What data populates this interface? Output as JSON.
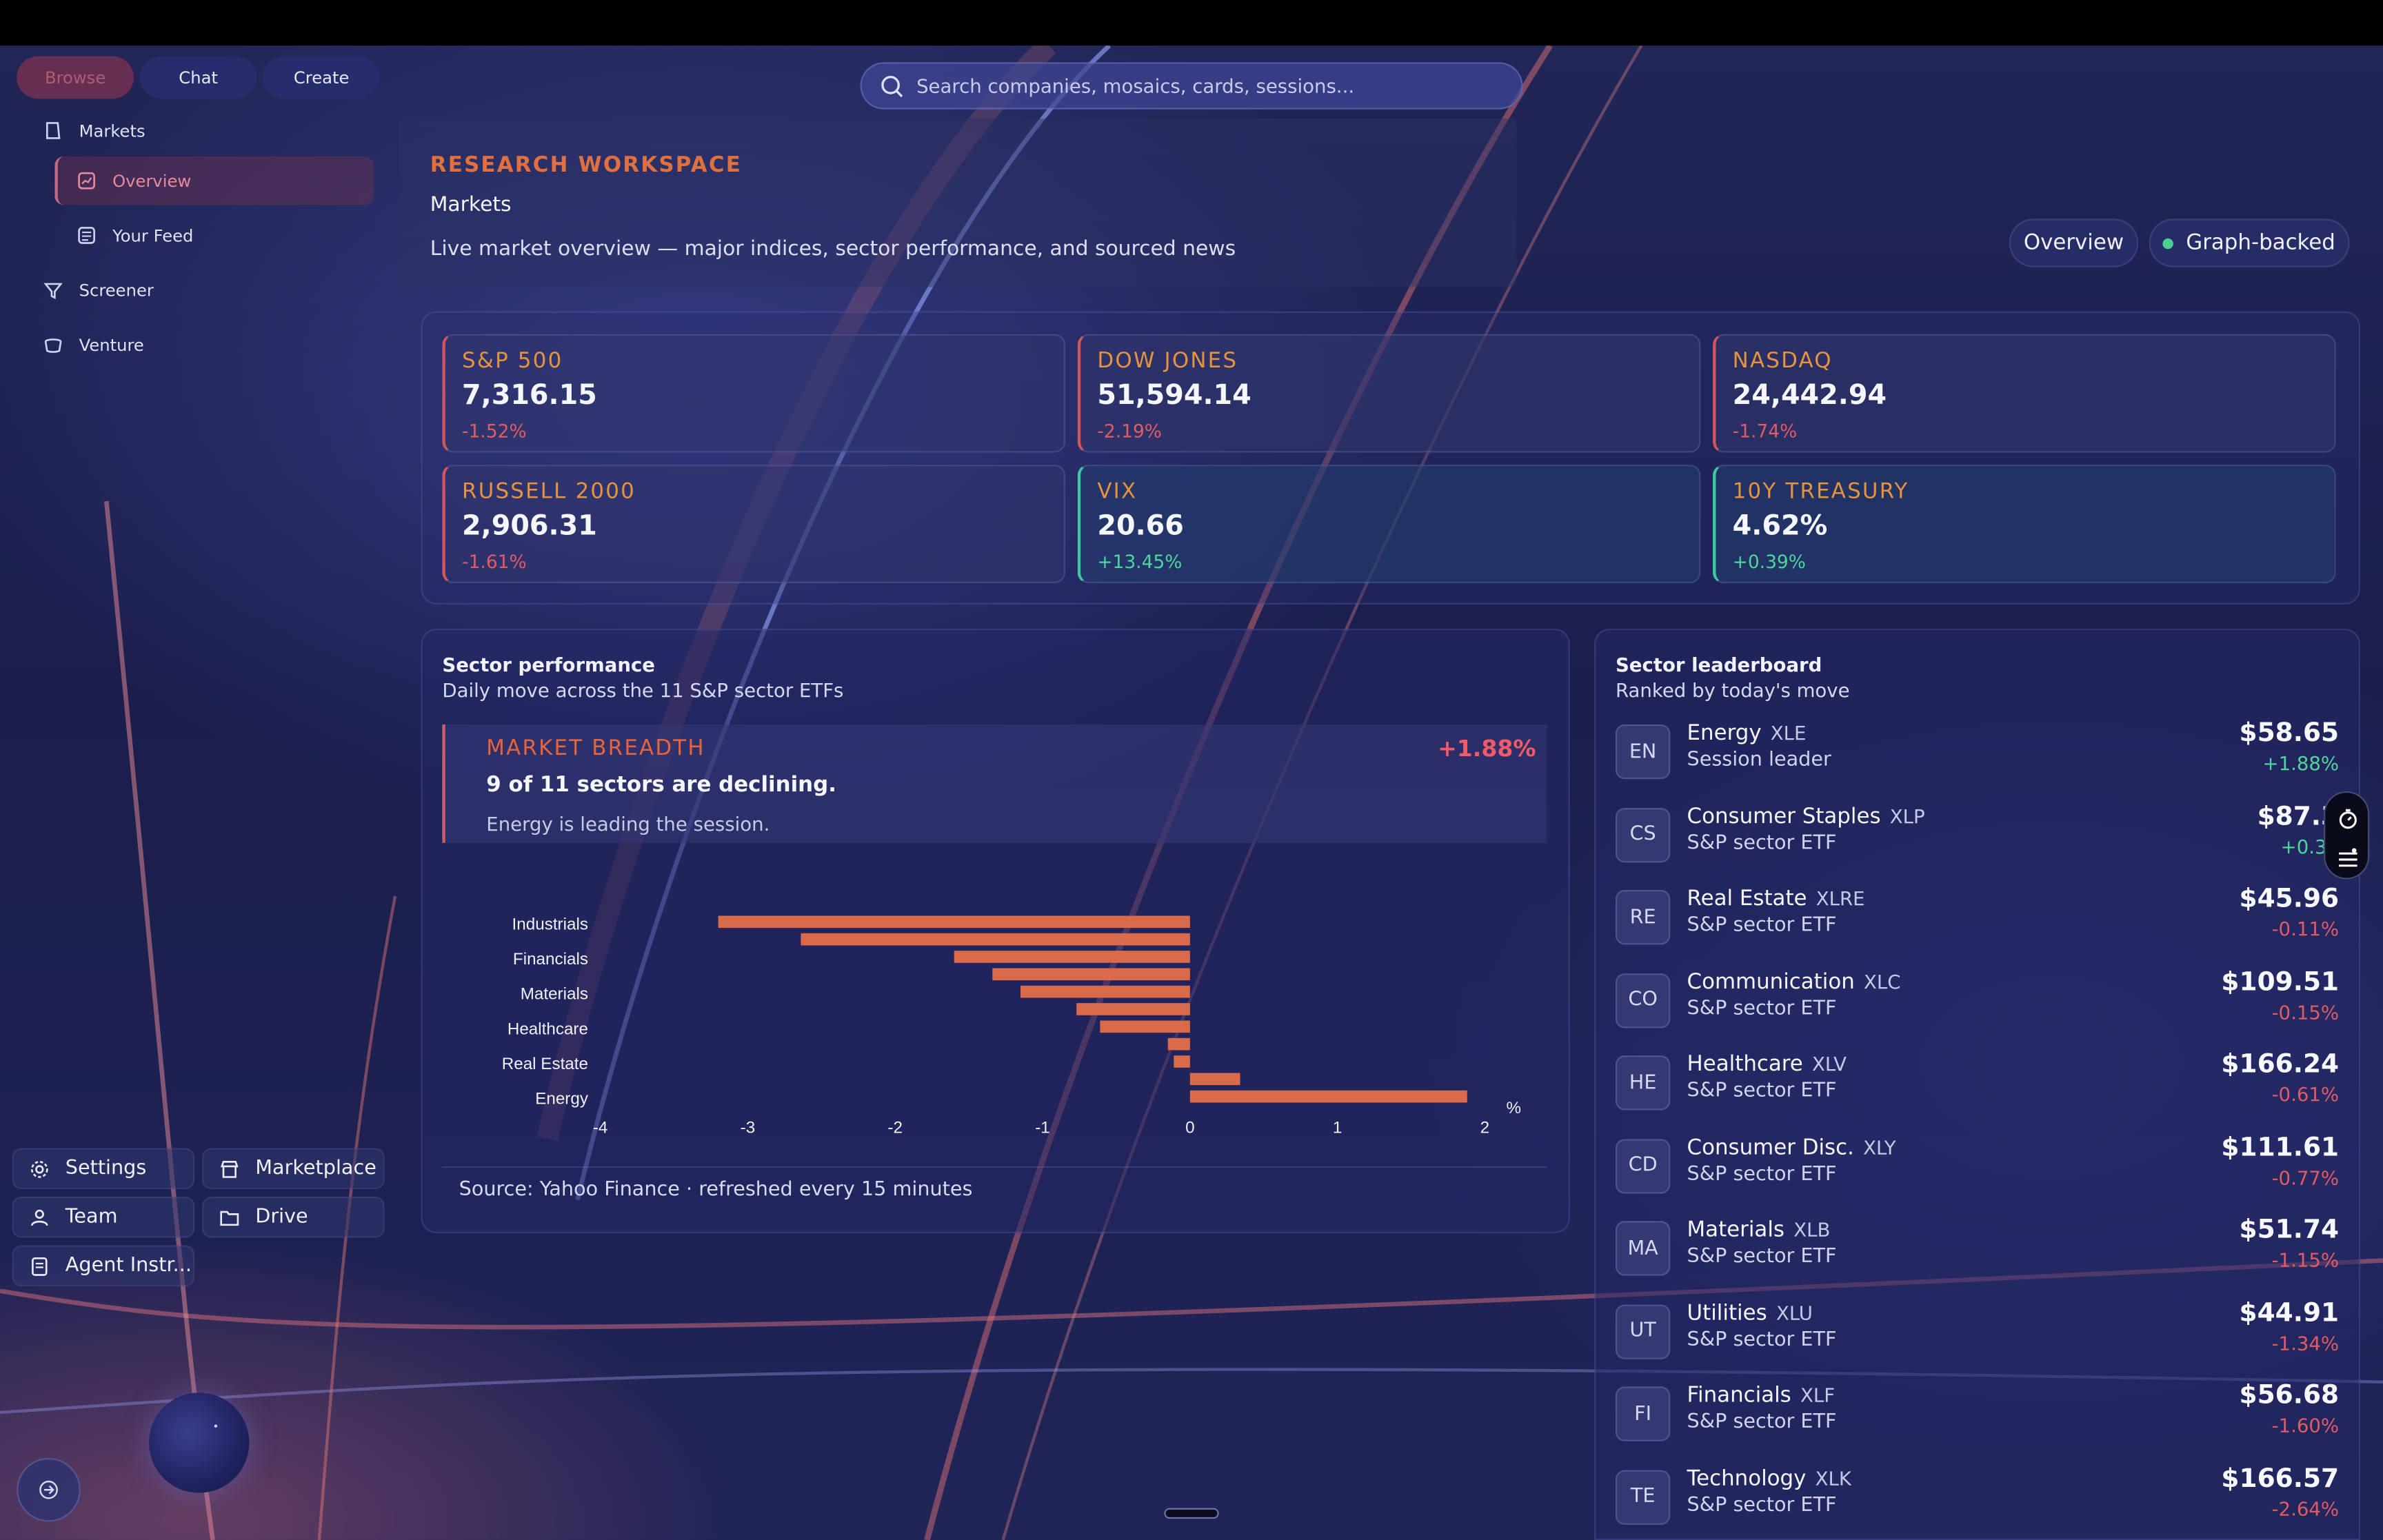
{
  "tabs": [
    "Browse",
    "Chat",
    "Create"
  ],
  "nav": {
    "markets": "Markets",
    "overview": "Overview",
    "your_feed": "Your Feed",
    "screener": "Screener",
    "venture": "Venture"
  },
  "sidebar_bottom": {
    "settings": "Settings",
    "marketplace": "Marketplace",
    "team": "Team",
    "drive": "Drive",
    "agent": "Agent Instr..."
  },
  "search": {
    "placeholder": "Search companies, mosaics, cards, sessions..."
  },
  "header": {
    "kicker": "RESEARCH WORKSPACE",
    "title": "Markets",
    "description": "Live market overview — major indices, sector performance, and sourced news",
    "pill_overview": "Overview",
    "pill_graph": "Graph-backed"
  },
  "indices": [
    {
      "name": "S&P 500",
      "value": "7,316.15",
      "change": "-1.52%",
      "direction": "down"
    },
    {
      "name": "DOW JONES",
      "value": "51,594.14",
      "change": "-2.19%",
      "direction": "down"
    },
    {
      "name": "NASDAQ",
      "value": "24,442.94",
      "change": "-1.74%",
      "direction": "down"
    },
    {
      "name": "RUSSELL 2000",
      "value": "2,906.31",
      "change": "-1.61%",
      "direction": "down"
    },
    {
      "name": "VIX",
      "value": "20.66",
      "change": "+13.45%",
      "direction": "up"
    },
    {
      "name": "10Y TREASURY",
      "value": "4.62%",
      "change": "+0.39%",
      "direction": "up"
    }
  ],
  "sector_performance": {
    "title": "Sector performance",
    "subtitle": "Daily move across the 11 S&P sector ETFs",
    "breadth_kicker": "MARKET BREADTH",
    "breadth_value": "+1.88%",
    "breadth_headline": "9 of 11 sectors are declining.",
    "breadth_note": "Energy is leading the session.",
    "source": "Source: Yahoo Finance · refreshed every 15 minutes"
  },
  "chart_data": {
    "type": "bar",
    "orientation": "horizontal",
    "title": "",
    "xlabel": "%",
    "ylabel": "",
    "xlim": [
      -4,
      2
    ],
    "xticks": [
      "-4",
      "-3",
      "-2",
      "-1",
      "0",
      "1",
      "2"
    ],
    "labeled_categories": [
      "Industrials",
      "Financials",
      "Materials",
      "Healthcare",
      "Real Estate",
      "Energy"
    ],
    "values": [
      -3.2,
      -2.64,
      -1.6,
      -1.34,
      -1.15,
      -0.77,
      -0.61,
      -0.15,
      -0.11,
      0.34,
      1.88
    ],
    "bar_color": "#d96a4a",
    "grid": false,
    "legend": "none"
  },
  "leaderboard": {
    "title": "Sector leaderboard",
    "subtitle": "Ranked by today's move",
    "rows": [
      {
        "abbr": "EN",
        "name": "Energy",
        "ticker": "XLE",
        "sub": "Session leader",
        "price": "$58.65",
        "change": "+1.88%",
        "direction": "up"
      },
      {
        "abbr": "CS",
        "name": "Consumer Staples",
        "ticker": "XLP",
        "sub": "S&P sector ETF",
        "price": "$87.3",
        "change": "+0.34",
        "direction": "up"
      },
      {
        "abbr": "RE",
        "name": "Real Estate",
        "ticker": "XLRE",
        "sub": "S&P sector ETF",
        "price": "$45.96",
        "change": "-0.11%",
        "direction": "down"
      },
      {
        "abbr": "CO",
        "name": "Communication",
        "ticker": "XLC",
        "sub": "S&P sector ETF",
        "price": "$109.51",
        "change": "-0.15%",
        "direction": "down"
      },
      {
        "abbr": "HE",
        "name": "Healthcare",
        "ticker": "XLV",
        "sub": "S&P sector ETF",
        "price": "$166.24",
        "change": "-0.61%",
        "direction": "down"
      },
      {
        "abbr": "CD",
        "name": "Consumer Disc.",
        "ticker": "XLY",
        "sub": "S&P sector ETF",
        "price": "$111.61",
        "change": "-0.77%",
        "direction": "down"
      },
      {
        "abbr": "MA",
        "name": "Materials",
        "ticker": "XLB",
        "sub": "S&P sector ETF",
        "price": "$51.74",
        "change": "-1.15%",
        "direction": "down"
      },
      {
        "abbr": "UT",
        "name": "Utilities",
        "ticker": "XLU",
        "sub": "S&P sector ETF",
        "price": "$44.91",
        "change": "-1.34%",
        "direction": "down"
      },
      {
        "abbr": "FI",
        "name": "Financials",
        "ticker": "XLF",
        "sub": "S&P sector ETF",
        "price": "$56.68",
        "change": "-1.60%",
        "direction": "down"
      },
      {
        "abbr": "TE",
        "name": "Technology",
        "ticker": "XLK",
        "sub": "S&P sector ETF",
        "price": "$166.57",
        "change": "-2.64%",
        "direction": "down"
      }
    ]
  },
  "colors": {
    "accent_orange": "#e0703f",
    "down_red": "#e25b63",
    "up_green": "#4fd49e",
    "background_navy": "#1d2050"
  },
  "icons": [
    "search-icon",
    "markets-icon",
    "overview-icon",
    "feed-icon",
    "screener-icon",
    "venture-icon",
    "gear-icon",
    "marketplace-icon",
    "team-icon",
    "drive-icon",
    "document-icon",
    "arrow-icon",
    "timer-icon",
    "list-icon"
  ]
}
